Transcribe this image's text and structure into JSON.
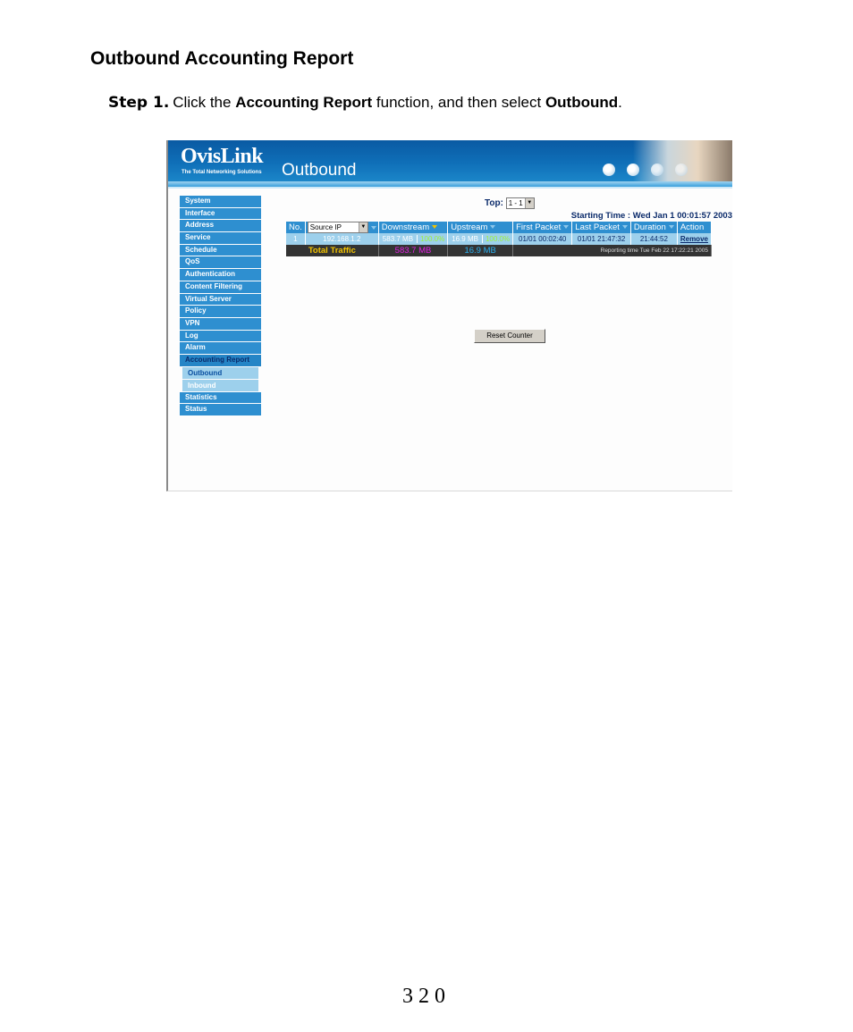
{
  "doc": {
    "title": "Outbound Accounting Report",
    "step_label": "Step 1.",
    "step_text_1": "Click the ",
    "step_bold_1": "Accounting Report",
    "step_text_2": " function, and then select ",
    "step_bold_2": "Outbound",
    "step_text_3": ".",
    "page_number": "320"
  },
  "app": {
    "brand": "OvisLink",
    "brand_tagline": "The Total Networking Solutions",
    "page_title": "Outbound",
    "colors": {
      "nav": "#2e8fd0",
      "subnav": "#9dd0ec",
      "total_row": "#333333",
      "highlight": "#f2c200"
    }
  },
  "sidebar": {
    "items": [
      {
        "label": "System"
      },
      {
        "label": "Interface"
      },
      {
        "label": "Address"
      },
      {
        "label": "Service"
      },
      {
        "label": "Schedule"
      },
      {
        "label": "QoS"
      },
      {
        "label": "Authentication"
      },
      {
        "label": "Content Filtering"
      },
      {
        "label": "Virtual Server"
      },
      {
        "label": "Policy"
      },
      {
        "label": "VPN"
      },
      {
        "label": "Log"
      },
      {
        "label": "Alarm"
      },
      {
        "label": "Accounting Report"
      }
    ],
    "sub_items": [
      {
        "label": "Outbound"
      },
      {
        "label": "Inbound"
      }
    ],
    "items_after": [
      {
        "label": "Statistics"
      },
      {
        "label": "Status"
      }
    ]
  },
  "report": {
    "top_label": "Top:",
    "top_value": "1 - 1",
    "starting_time": "Starting Time : Wed Jan 1 00:01:57 2003",
    "columns": {
      "no": "No.",
      "source": "Source IP",
      "downstream": "Downstream",
      "upstream": "Upstream",
      "first_packet": "First Packet",
      "last_packet": "Last Packet",
      "duration": "Duration",
      "action": "Action"
    },
    "rows": [
      {
        "no": "1",
        "source": "192.168.1.2",
        "downstream": "583.7 MB",
        "downstream_pct": "100.0%",
        "upstream": "16.9 MB",
        "upstream_pct": "100.0%",
        "first_packet": "01/01 00:02:40",
        "last_packet": "01/01 21:47:32",
        "duration": "21:44:52",
        "action": "Remove"
      }
    ],
    "total": {
      "label": "Total Traffic",
      "downstream": "583.7 MB",
      "upstream": "16.9 MB",
      "reporting_time": "Reporting time Tue Feb 22 17:22:21 2005"
    },
    "reset_button": "Reset Counter"
  }
}
